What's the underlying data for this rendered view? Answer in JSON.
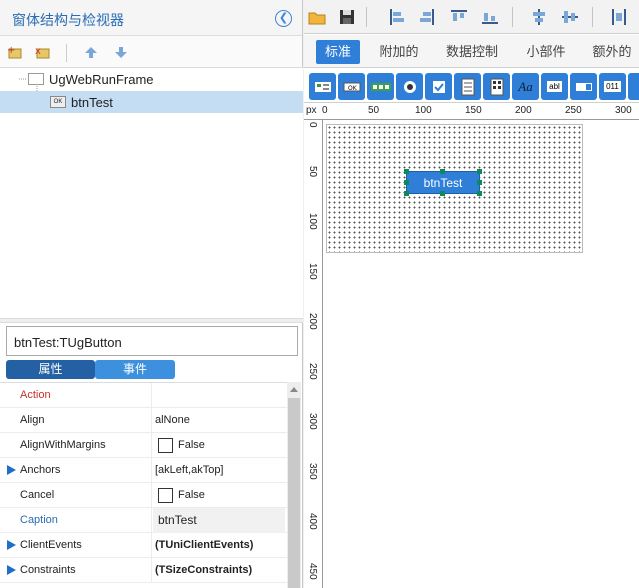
{
  "left_panel": {
    "title": "窗体结构与检视器",
    "tree": [
      {
        "label": "UgWebRunFrame",
        "icon_text": ""
      },
      {
        "label": "btnTest",
        "icon_text": "OK"
      }
    ],
    "component_name": "btnTest:TUgButton",
    "prop_tabs": {
      "properties": "属性",
      "events": "事件"
    },
    "properties": [
      {
        "name": "Action",
        "value": "",
        "color": "red",
        "arrow": false
      },
      {
        "name": "Align",
        "value": "alNone",
        "color": "",
        "arrow": false
      },
      {
        "name": "AlignWithMargins",
        "value": "False",
        "color": "",
        "arrow": false,
        "checkbox": true
      },
      {
        "name": "Anchors",
        "value": "[akLeft,akTop]",
        "color": "",
        "arrow": true
      },
      {
        "name": "Cancel",
        "value": "False",
        "color": "",
        "arrow": false,
        "checkbox": true
      },
      {
        "name": "Caption",
        "value": "btnTest",
        "color": "blue",
        "arrow": false,
        "highlight": true
      },
      {
        "name": "ClientEvents",
        "value": "(TUniClientEvents)",
        "color": "",
        "arrow": true,
        "bold": true
      },
      {
        "name": "Constraints",
        "value": "(TSizeConstraints)",
        "color": "",
        "arrow": true,
        "bold": true
      }
    ]
  },
  "designer": {
    "tabs": [
      "标准",
      "附加的",
      "数据控制",
      "小部件",
      "额外的"
    ],
    "active_tab": "标准",
    "palette_labels": {
      "font": "Aa",
      "edit": "abl",
      "spin": "011"
    },
    "ruler_unit": "px",
    "ruler_h": [
      "0",
      "50",
      "100",
      "150",
      "200",
      "250",
      "300"
    ],
    "ruler_v": [
      "0",
      "50",
      "100",
      "150",
      "200",
      "250",
      "300",
      "350",
      "400",
      "450"
    ],
    "button_caption": "btnTest"
  },
  "colors": {
    "accent": "#2f7ed8",
    "dark_tab": "#2461a4",
    "selection": "#c4ddf2"
  }
}
